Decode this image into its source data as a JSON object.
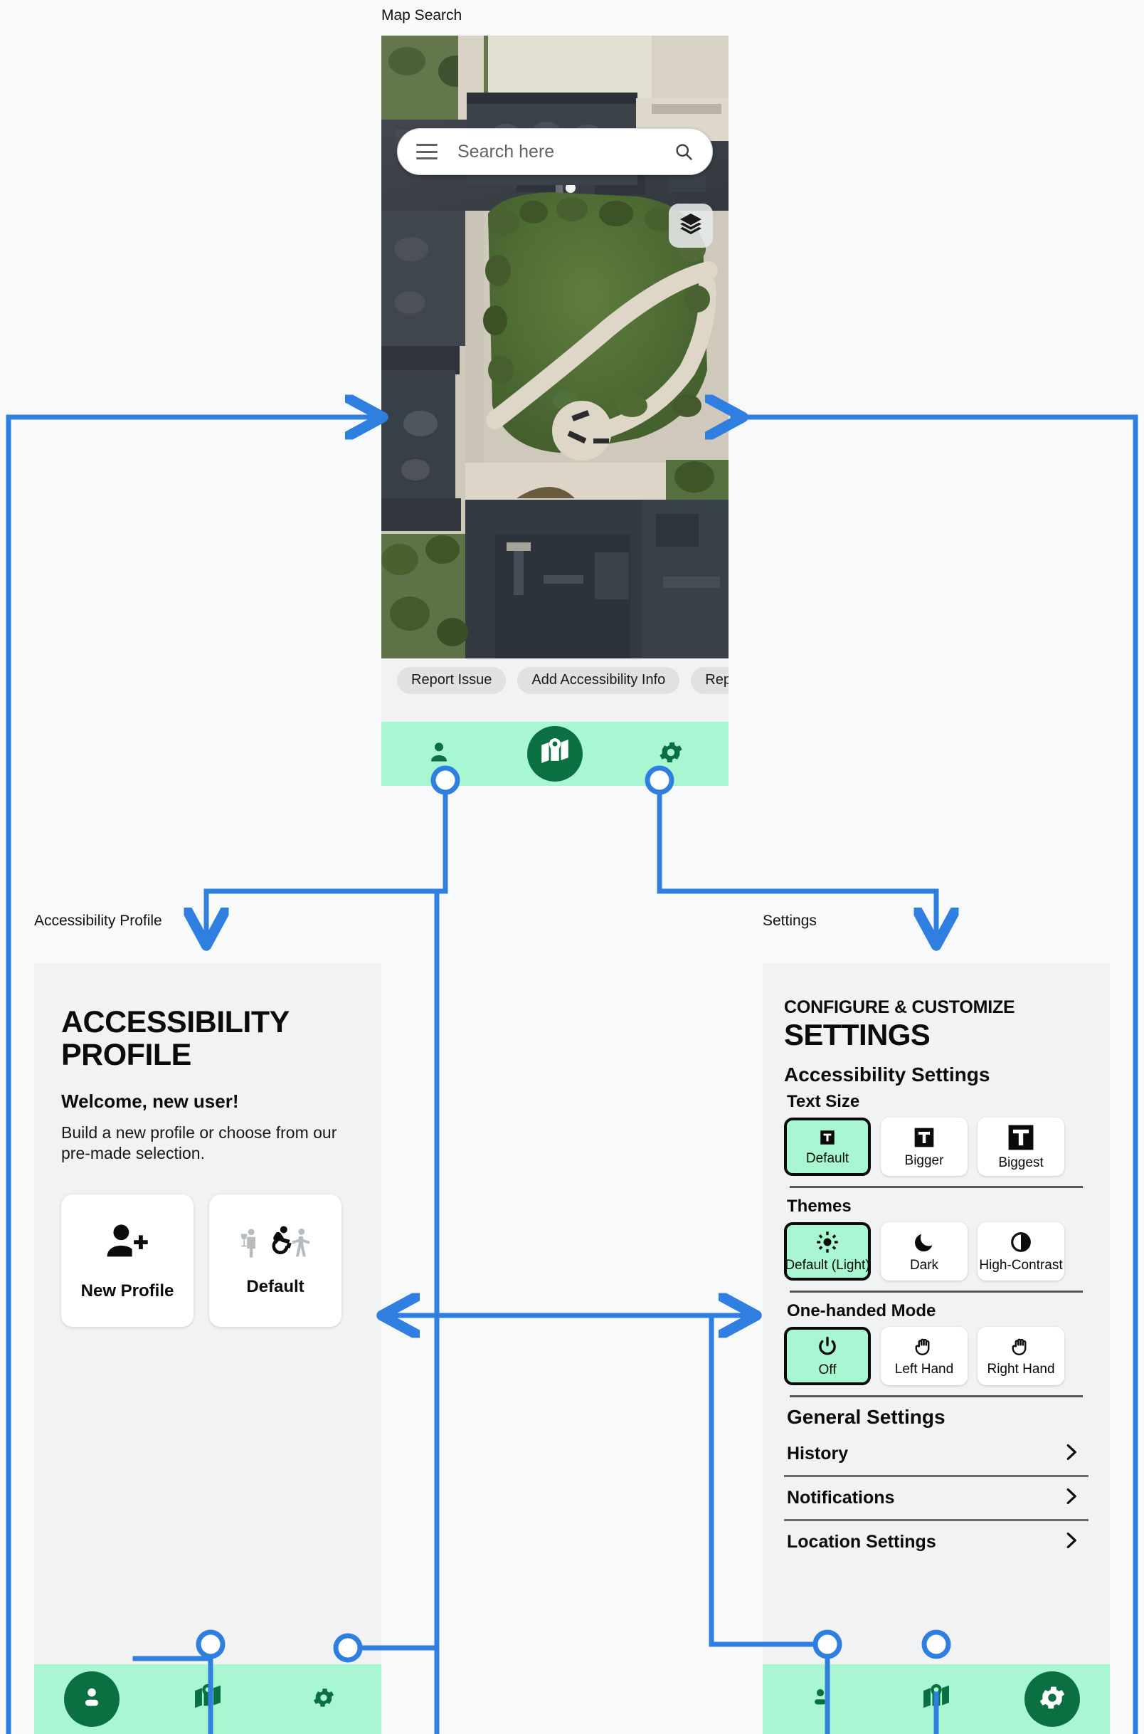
{
  "screens": {
    "map": {
      "label": "Map Search",
      "search": {
        "placeholder": "Search here",
        "menu_icon": "hamburger-menu-icon",
        "search_icon": "search-icon"
      },
      "layers_icon": "layers-icon",
      "chips": [
        "Report Issue",
        "Add Accessibility Info",
        "Reporte"
      ],
      "nav": [
        {
          "icon": "person-icon",
          "name": "profile",
          "active": false
        },
        {
          "icon": "map-pin-icon",
          "name": "map",
          "active": true
        },
        {
          "icon": "gear-icon",
          "name": "settings",
          "active": false
        }
      ]
    },
    "profile": {
      "label": "Accessibility Profile",
      "title": "ACCESSIBILITY PROFILE",
      "welcome": "Welcome, new user!",
      "subtitle": "Build a new profile or choose from our pre-made selection.",
      "cards": [
        {
          "label": "New Profile",
          "icon": "person-add-icon"
        },
        {
          "label": "Default",
          "icon": "accessibility-group-icon"
        }
      ],
      "nav": [
        {
          "icon": "person-icon",
          "name": "profile",
          "active": true
        },
        {
          "icon": "map-pin-icon",
          "name": "map",
          "active": false
        },
        {
          "icon": "gear-icon",
          "name": "settings",
          "active": false
        }
      ]
    },
    "settings": {
      "label": "Settings",
      "kicker": "CONFIGURE & CUSTOMIZE",
      "title": "SETTINGS",
      "accessibility_heading": "Accessibility Settings",
      "groups": [
        {
          "heading": "Text Size",
          "options": [
            {
              "label": "Default",
              "icon": "text-size-small-icon",
              "selected": true
            },
            {
              "label": "Bigger",
              "icon": "text-size-medium-icon",
              "selected": false
            },
            {
              "label": "Biggest",
              "icon": "text-size-large-icon",
              "selected": false
            }
          ]
        },
        {
          "heading": "Themes",
          "options": [
            {
              "label": "Default (Light)",
              "icon": "sun-icon",
              "selected": true
            },
            {
              "label": "Dark",
              "icon": "moon-icon",
              "selected": false
            },
            {
              "label": "High-Contrast",
              "icon": "contrast-icon",
              "selected": false
            }
          ]
        },
        {
          "heading": "One-handed Mode",
          "options": [
            {
              "label": "Off",
              "icon": "power-icon",
              "selected": true
            },
            {
              "label": "Left Hand",
              "icon": "hand-left-icon",
              "selected": false
            },
            {
              "label": "Right Hand",
              "icon": "hand-right-icon",
              "selected": false
            }
          ]
        }
      ],
      "general_heading": "General Settings",
      "general_rows": [
        {
          "label": "History",
          "icon": "chevron-right-icon"
        },
        {
          "label": "Notifications",
          "icon": "chevron-right-icon"
        },
        {
          "label": "Location Settings",
          "icon": "chevron-right-icon"
        }
      ],
      "nav": [
        {
          "icon": "person-icon",
          "name": "profile",
          "active": false
        },
        {
          "icon": "map-pin-icon",
          "name": "map",
          "active": false
        },
        {
          "icon": "gear-icon",
          "name": "settings",
          "active": true
        }
      ]
    }
  },
  "colors": {
    "accent_mint": "#a8f7d2",
    "accent_green": "#0a7042",
    "connector_blue": "#2f7fe0",
    "page_bg": "#f8f9fa",
    "screen_bg": "#f1f2f3"
  }
}
